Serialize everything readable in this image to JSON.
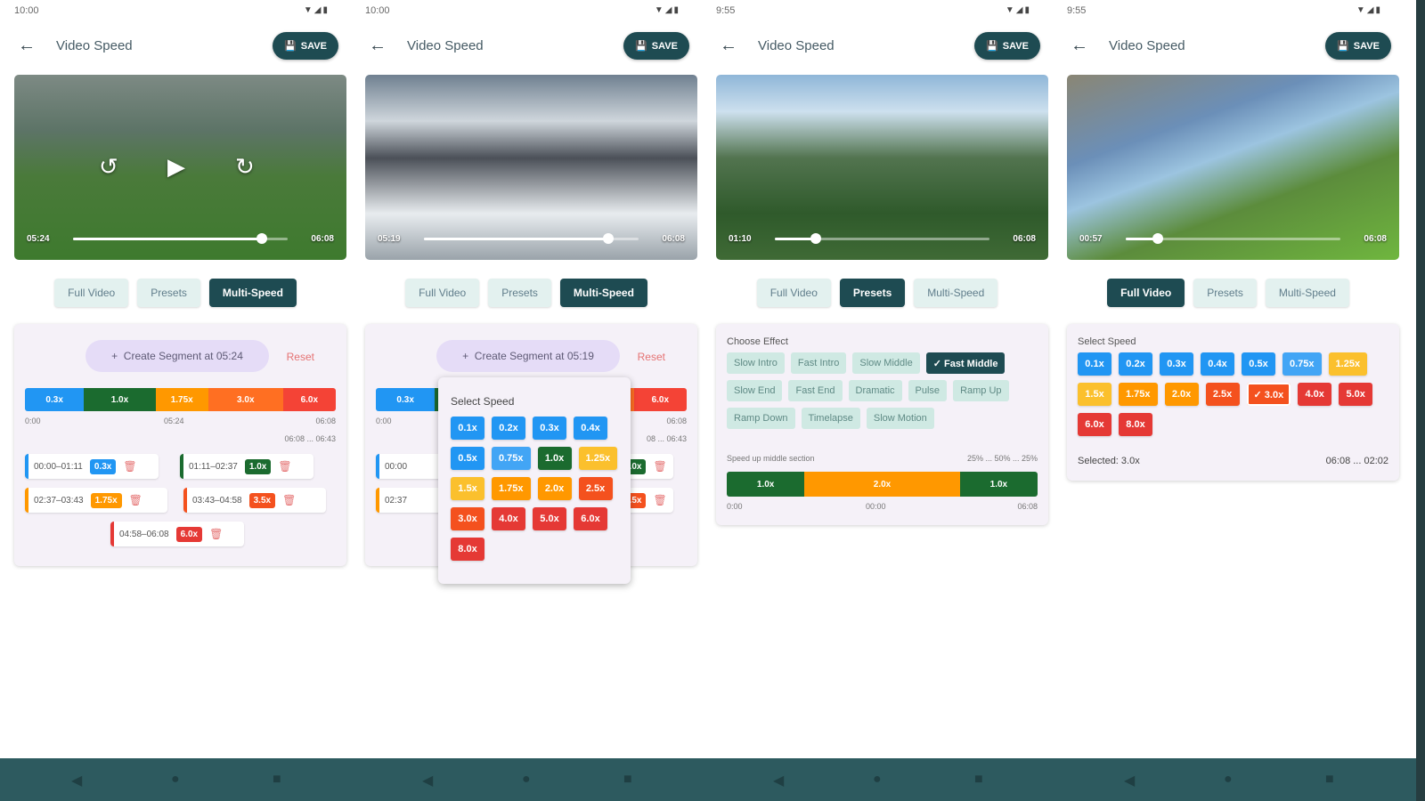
{
  "app_title": "Video Speed",
  "save_label": "SAVE",
  "tabs": [
    "Full Video",
    "Presets",
    "Multi-Speed"
  ],
  "screens": [
    {
      "time": "10:00",
      "video_current": "05:24",
      "video_total": "06:08",
      "progress": 0.88,
      "active_tab": 2
    },
    {
      "time": "10:00",
      "video_current": "05:19",
      "video_total": "06:08",
      "progress": 0.86,
      "active_tab": 2
    },
    {
      "time": "9:55",
      "video_current": "01:10",
      "video_total": "06:08",
      "progress": 0.19,
      "active_tab": 1
    },
    {
      "time": "9:55",
      "video_current": "00:57",
      "video_total": "06:08",
      "progress": 0.15,
      "active_tab": 0
    }
  ],
  "multi1": {
    "create_label": "Create Segment at 05:24",
    "reset_label": "Reset",
    "timeline": [
      {
        "label": "0.3x",
        "color": "#2196f3",
        "frac": 0.19
      },
      {
        "label": "1.0x",
        "color": "#1b6b2f",
        "frac": 0.23
      },
      {
        "label": "1.75x",
        "color": "#ff9800",
        "frac": 0.17
      },
      {
        "label": "3.0x",
        "color": "#ff6f22",
        "frac": 0.24
      },
      {
        "label": "6.0x",
        "color": "#f44336",
        "frac": 0.17
      }
    ],
    "axis_start": "0:00",
    "axis_mid": "05:24",
    "axis_end": "06:08",
    "range": "06:08 ... 06:43",
    "segments": [
      {
        "range": "00:00–01:11",
        "speed": "0.3x",
        "color": "#2196f3"
      },
      {
        "range": "01:11–02:37",
        "speed": "1.0x",
        "color": "#1b6b2f"
      },
      {
        "range": "02:37–03:43",
        "speed": "1.75x",
        "color": "#ff9800"
      },
      {
        "range": "03:43–04:58",
        "speed": "3.5x",
        "color": "#f4511e"
      },
      {
        "range": "04:58–06:08",
        "speed": "6.0x",
        "color": "#e53935"
      }
    ]
  },
  "multi2": {
    "create_label": "Create Segment at 05:19",
    "reset_label": "Reset",
    "popup_title": "Select Speed",
    "speeds": [
      {
        "label": "0.1x",
        "color": "#2196f3"
      },
      {
        "label": "0.2x",
        "color": "#2196f3"
      },
      {
        "label": "0.3x",
        "color": "#2196f3"
      },
      {
        "label": "0.4x",
        "color": "#2196f3"
      },
      {
        "label": "0.5x",
        "color": "#2196f3"
      },
      {
        "label": "0.75x",
        "color": "#42a5f5"
      },
      {
        "label": "1.0x",
        "color": "#1b6b2f"
      },
      {
        "label": "1.25x",
        "color": "#fbc02d"
      },
      {
        "label": "1.5x",
        "color": "#fbc02d"
      },
      {
        "label": "1.75x",
        "color": "#ff9800"
      },
      {
        "label": "2.0x",
        "color": "#ff9800"
      },
      {
        "label": "2.5x",
        "color": "#f4511e"
      },
      {
        "label": "3.0x",
        "color": "#f4511e"
      },
      {
        "label": "4.0x",
        "color": "#e53935"
      },
      {
        "label": "5.0x",
        "color": "#e53935"
      },
      {
        "label": "6.0x",
        "color": "#e53935"
      },
      {
        "label": "8.0x",
        "color": "#e53935"
      }
    ],
    "segment_partials": [
      "00:00",
      "02:37"
    ],
    "partial_right": [
      "08 ... 06:43"
    ]
  },
  "presets": {
    "section_title": "Choose Effect",
    "effects": [
      "Slow Intro",
      "Fast Intro",
      "Slow Middle",
      "Fast Middle",
      "Slow End",
      "Fast End",
      "Dramatic",
      "Pulse",
      "Ramp Up",
      "Ramp Down",
      "Timelapse",
      "Slow Motion"
    ],
    "active_effect": 3,
    "caption": "Speed up middle section",
    "pct": "25% ... 50% ... 25%",
    "bar": [
      {
        "label": "1.0x",
        "color": "#1b6b2f",
        "frac": 0.25
      },
      {
        "label": "2.0x",
        "color": "#ff9800",
        "frac": 0.5
      },
      {
        "label": "1.0x",
        "color": "#1b6b2f",
        "frac": 0.25
      }
    ],
    "axis": [
      "0:00",
      "00:00",
      "06:08"
    ]
  },
  "fullvideo": {
    "section_title": "Select Speed",
    "speeds": [
      {
        "label": "0.1x",
        "color": "#2196f3"
      },
      {
        "label": "0.2x",
        "color": "#2196f3"
      },
      {
        "label": "0.3x",
        "color": "#2196f3"
      },
      {
        "label": "0.4x",
        "color": "#2196f3"
      },
      {
        "label": "0.5x",
        "color": "#2196f3"
      },
      {
        "label": "0.75x",
        "color": "#42a5f5"
      },
      {
        "label": "1.25x",
        "color": "#fbc02d"
      },
      {
        "label": "1.5x",
        "color": "#fbc02d"
      },
      {
        "label": "1.75x",
        "color": "#ff9800"
      },
      {
        "label": "2.0x",
        "color": "#ff9800"
      },
      {
        "label": "2.5x",
        "color": "#f4511e"
      },
      {
        "label": "3.0x",
        "color": "#f4511e"
      },
      {
        "label": "4.0x",
        "color": "#e53935"
      },
      {
        "label": "5.0x",
        "color": "#e53935"
      },
      {
        "label": "6.0x",
        "color": "#e53935"
      },
      {
        "label": "8.0x",
        "color": "#e53935"
      }
    ],
    "selected_index": 11,
    "selected_label": "Selected: 3.0x",
    "selected_range": "06:08 ... 02:02"
  },
  "nav_icons": [
    "back-nav-icon",
    "home-nav-icon",
    "recents-nav-icon"
  ]
}
